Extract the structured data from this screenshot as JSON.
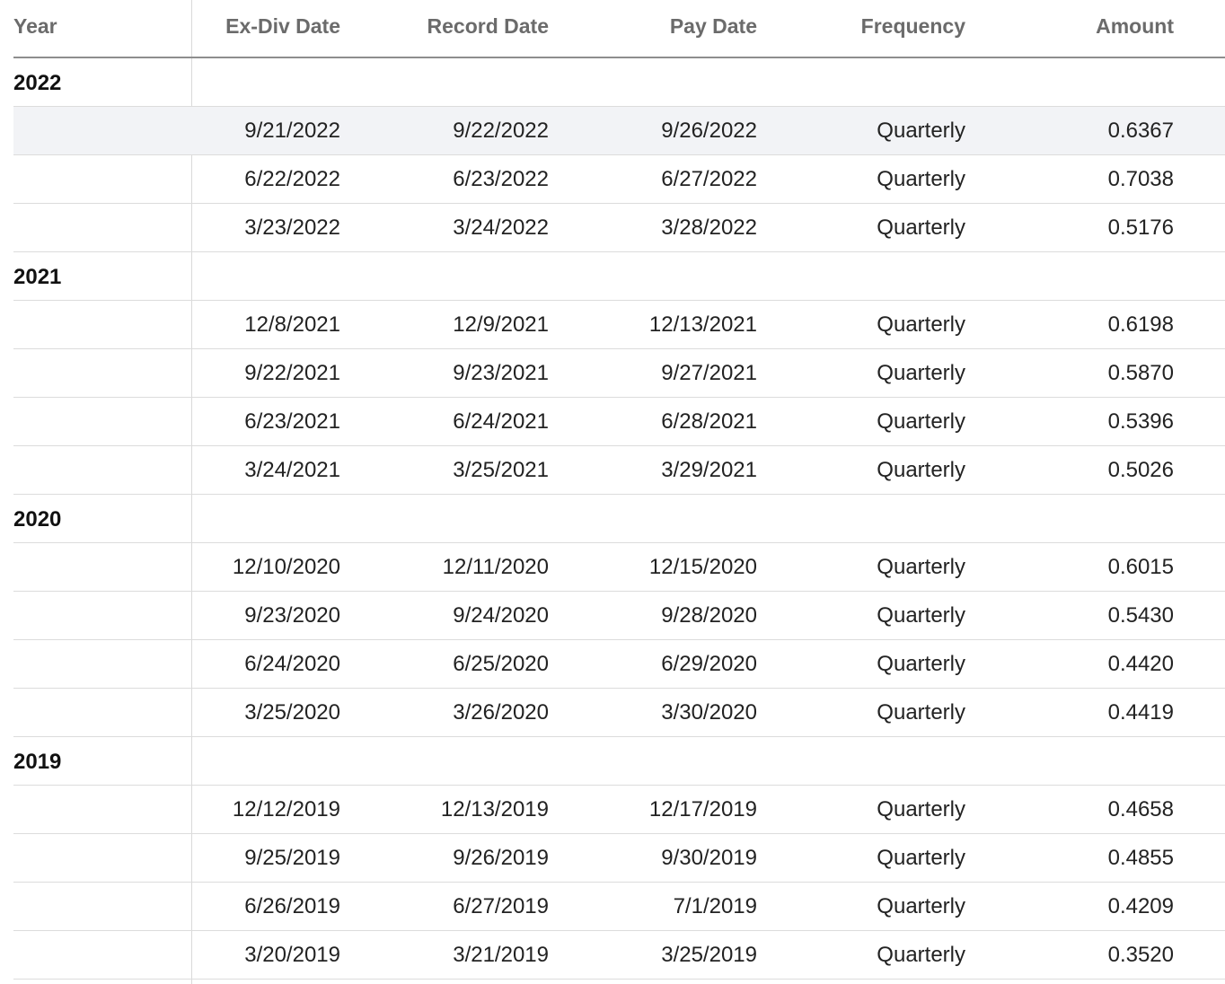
{
  "columns": {
    "year": "Year",
    "ex_div": "Ex-Div Date",
    "record": "Record Date",
    "pay": "Pay Date",
    "frequency": "Frequency",
    "amount": "Amount"
  },
  "groups": [
    {
      "year": "2022",
      "rows": [
        {
          "ex_div": "9/21/2022",
          "record": "9/22/2022",
          "pay": "9/26/2022",
          "frequency": "Quarterly",
          "amount": "0.6367"
        },
        {
          "ex_div": "6/22/2022",
          "record": "6/23/2022",
          "pay": "6/27/2022",
          "frequency": "Quarterly",
          "amount": "0.7038"
        },
        {
          "ex_div": "3/23/2022",
          "record": "3/24/2022",
          "pay": "3/28/2022",
          "frequency": "Quarterly",
          "amount": "0.5176"
        }
      ]
    },
    {
      "year": "2021",
      "rows": [
        {
          "ex_div": "12/8/2021",
          "record": "12/9/2021",
          "pay": "12/13/2021",
          "frequency": "Quarterly",
          "amount": "0.6198"
        },
        {
          "ex_div": "9/22/2021",
          "record": "9/23/2021",
          "pay": "9/27/2021",
          "frequency": "Quarterly",
          "amount": "0.5870"
        },
        {
          "ex_div": "6/23/2021",
          "record": "6/24/2021",
          "pay": "6/28/2021",
          "frequency": "Quarterly",
          "amount": "0.5396"
        },
        {
          "ex_div": "3/24/2021",
          "record": "3/25/2021",
          "pay": "3/29/2021",
          "frequency": "Quarterly",
          "amount": "0.5026"
        }
      ]
    },
    {
      "year": "2020",
      "rows": [
        {
          "ex_div": "12/10/2020",
          "record": "12/11/2020",
          "pay": "12/15/2020",
          "frequency": "Quarterly",
          "amount": "0.6015"
        },
        {
          "ex_div": "9/23/2020",
          "record": "9/24/2020",
          "pay": "9/28/2020",
          "frequency": "Quarterly",
          "amount": "0.5430"
        },
        {
          "ex_div": "6/24/2020",
          "record": "6/25/2020",
          "pay": "6/29/2020",
          "frequency": "Quarterly",
          "amount": "0.4420"
        },
        {
          "ex_div": "3/25/2020",
          "record": "3/26/2020",
          "pay": "3/30/2020",
          "frequency": "Quarterly",
          "amount": "0.4419"
        }
      ]
    },
    {
      "year": "2019",
      "rows": [
        {
          "ex_div": "12/12/2019",
          "record": "12/13/2019",
          "pay": "12/17/2019",
          "frequency": "Quarterly",
          "amount": "0.4658"
        },
        {
          "ex_div": "9/25/2019",
          "record": "9/26/2019",
          "pay": "9/30/2019",
          "frequency": "Quarterly",
          "amount": "0.4855"
        },
        {
          "ex_div": "6/26/2019",
          "record": "6/27/2019",
          "pay": "7/1/2019",
          "frequency": "Quarterly",
          "amount": "0.4209"
        },
        {
          "ex_div": "3/20/2019",
          "record": "3/21/2019",
          "pay": "3/25/2019",
          "frequency": "Quarterly",
          "amount": "0.3520"
        }
      ]
    }
  ],
  "highlighted_row": "9/21/2022",
  "colors": {
    "header_text": "#6b6b6b",
    "row_highlight": "#f2f3f6",
    "divider": "#dcdcdc"
  }
}
